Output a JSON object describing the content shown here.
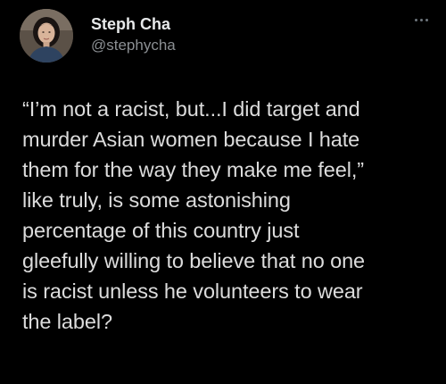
{
  "author": {
    "display_name": "Steph Cha",
    "handle": "@stephycha",
    "avatar_icon": "profile-photo"
  },
  "menu": {
    "icon": "more-options-icon"
  },
  "tweet": {
    "lines": [
      "“I’m not a racist, but...I did target and",
      "murder Asian women because I hate",
      "them for the way they make me feel,”",
      "like truly, is some astonishing",
      "percentage of this country just",
      "gleefully willing to believe that no one",
      "is racist unless he volunteers to wear",
      "the label?"
    ]
  },
  "colors": {
    "background": "#000000",
    "text": "#dcdcdc",
    "handle": "#8b8f93"
  }
}
